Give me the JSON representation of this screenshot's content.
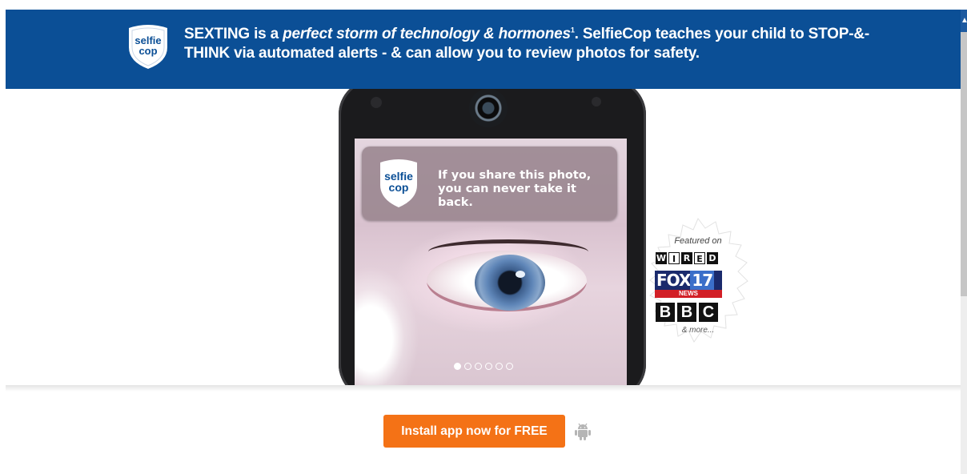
{
  "banner": {
    "logo_text_top": "selfie",
    "logo_text_bottom": "cop",
    "text_part1": "SEXTING is a ",
    "text_italic": "perfect storm of technology & hormones",
    "footnote_marker": "1",
    "text_part2": ". SelfieCop teaches your child to STOP-&-THINK via automated alerts - & can allow you to review photos for safety.",
    "background_color": "#0b4f96"
  },
  "phone": {
    "popup_logo_top": "selfie",
    "popup_logo_bottom": "cop",
    "popup_line1": "If you share this photo,",
    "popup_line2": "you can never take it back.",
    "carousel_slides": 6,
    "carousel_active_index": 0
  },
  "featured": {
    "label": "Featured on",
    "wired": [
      "W",
      "I",
      "R",
      "E",
      "D"
    ],
    "fox_main": "FOX",
    "fox_number": "17",
    "fox_sub": "NEWS",
    "bbc": [
      "B",
      "B",
      "C"
    ],
    "more": "& more..."
  },
  "cta": {
    "install_label": "Install app now for FREE",
    "button_color": "#f47216",
    "platform_icon": "android-icon"
  }
}
